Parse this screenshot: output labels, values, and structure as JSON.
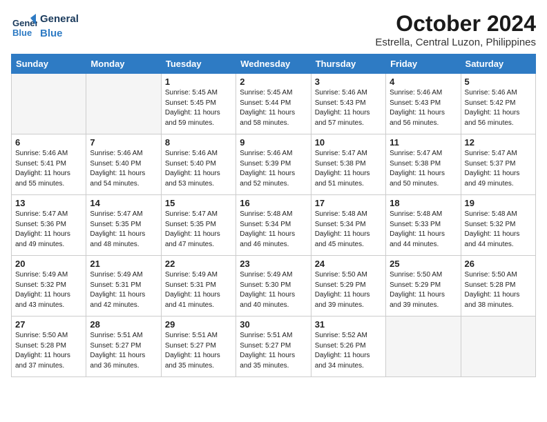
{
  "header": {
    "logo_general": "General",
    "logo_blue": "Blue",
    "month": "October 2024",
    "location": "Estrella, Central Luzon, Philippines"
  },
  "days_of_week": [
    "Sunday",
    "Monday",
    "Tuesday",
    "Wednesday",
    "Thursday",
    "Friday",
    "Saturday"
  ],
  "weeks": [
    [
      {
        "day": "",
        "info": ""
      },
      {
        "day": "",
        "info": ""
      },
      {
        "day": "1",
        "info": "Sunrise: 5:45 AM\nSunset: 5:45 PM\nDaylight: 11 hours and 59 minutes."
      },
      {
        "day": "2",
        "info": "Sunrise: 5:45 AM\nSunset: 5:44 PM\nDaylight: 11 hours and 58 minutes."
      },
      {
        "day": "3",
        "info": "Sunrise: 5:46 AM\nSunset: 5:43 PM\nDaylight: 11 hours and 57 minutes."
      },
      {
        "day": "4",
        "info": "Sunrise: 5:46 AM\nSunset: 5:43 PM\nDaylight: 11 hours and 56 minutes."
      },
      {
        "day": "5",
        "info": "Sunrise: 5:46 AM\nSunset: 5:42 PM\nDaylight: 11 hours and 56 minutes."
      }
    ],
    [
      {
        "day": "6",
        "info": "Sunrise: 5:46 AM\nSunset: 5:41 PM\nDaylight: 11 hours and 55 minutes."
      },
      {
        "day": "7",
        "info": "Sunrise: 5:46 AM\nSunset: 5:40 PM\nDaylight: 11 hours and 54 minutes."
      },
      {
        "day": "8",
        "info": "Sunrise: 5:46 AM\nSunset: 5:40 PM\nDaylight: 11 hours and 53 minutes."
      },
      {
        "day": "9",
        "info": "Sunrise: 5:46 AM\nSunset: 5:39 PM\nDaylight: 11 hours and 52 minutes."
      },
      {
        "day": "10",
        "info": "Sunrise: 5:47 AM\nSunset: 5:38 PM\nDaylight: 11 hours and 51 minutes."
      },
      {
        "day": "11",
        "info": "Sunrise: 5:47 AM\nSunset: 5:38 PM\nDaylight: 11 hours and 50 minutes."
      },
      {
        "day": "12",
        "info": "Sunrise: 5:47 AM\nSunset: 5:37 PM\nDaylight: 11 hours and 49 minutes."
      }
    ],
    [
      {
        "day": "13",
        "info": "Sunrise: 5:47 AM\nSunset: 5:36 PM\nDaylight: 11 hours and 49 minutes."
      },
      {
        "day": "14",
        "info": "Sunrise: 5:47 AM\nSunset: 5:35 PM\nDaylight: 11 hours and 48 minutes."
      },
      {
        "day": "15",
        "info": "Sunrise: 5:47 AM\nSunset: 5:35 PM\nDaylight: 11 hours and 47 minutes."
      },
      {
        "day": "16",
        "info": "Sunrise: 5:48 AM\nSunset: 5:34 PM\nDaylight: 11 hours and 46 minutes."
      },
      {
        "day": "17",
        "info": "Sunrise: 5:48 AM\nSunset: 5:34 PM\nDaylight: 11 hours and 45 minutes."
      },
      {
        "day": "18",
        "info": "Sunrise: 5:48 AM\nSunset: 5:33 PM\nDaylight: 11 hours and 44 minutes."
      },
      {
        "day": "19",
        "info": "Sunrise: 5:48 AM\nSunset: 5:32 PM\nDaylight: 11 hours and 44 minutes."
      }
    ],
    [
      {
        "day": "20",
        "info": "Sunrise: 5:49 AM\nSunset: 5:32 PM\nDaylight: 11 hours and 43 minutes."
      },
      {
        "day": "21",
        "info": "Sunrise: 5:49 AM\nSunset: 5:31 PM\nDaylight: 11 hours and 42 minutes."
      },
      {
        "day": "22",
        "info": "Sunrise: 5:49 AM\nSunset: 5:31 PM\nDaylight: 11 hours and 41 minutes."
      },
      {
        "day": "23",
        "info": "Sunrise: 5:49 AM\nSunset: 5:30 PM\nDaylight: 11 hours and 40 minutes."
      },
      {
        "day": "24",
        "info": "Sunrise: 5:50 AM\nSunset: 5:29 PM\nDaylight: 11 hours and 39 minutes."
      },
      {
        "day": "25",
        "info": "Sunrise: 5:50 AM\nSunset: 5:29 PM\nDaylight: 11 hours and 39 minutes."
      },
      {
        "day": "26",
        "info": "Sunrise: 5:50 AM\nSunset: 5:28 PM\nDaylight: 11 hours and 38 minutes."
      }
    ],
    [
      {
        "day": "27",
        "info": "Sunrise: 5:50 AM\nSunset: 5:28 PM\nDaylight: 11 hours and 37 minutes."
      },
      {
        "day": "28",
        "info": "Sunrise: 5:51 AM\nSunset: 5:27 PM\nDaylight: 11 hours and 36 minutes."
      },
      {
        "day": "29",
        "info": "Sunrise: 5:51 AM\nSunset: 5:27 PM\nDaylight: 11 hours and 35 minutes."
      },
      {
        "day": "30",
        "info": "Sunrise: 5:51 AM\nSunset: 5:27 PM\nDaylight: 11 hours and 35 minutes."
      },
      {
        "day": "31",
        "info": "Sunrise: 5:52 AM\nSunset: 5:26 PM\nDaylight: 11 hours and 34 minutes."
      },
      {
        "day": "",
        "info": ""
      },
      {
        "day": "",
        "info": ""
      }
    ]
  ]
}
